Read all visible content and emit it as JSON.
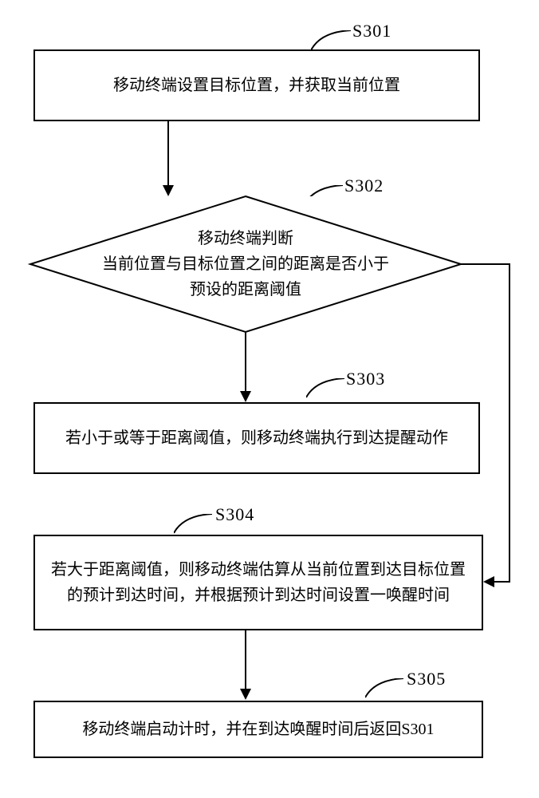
{
  "steps": {
    "s301": {
      "label": "S301",
      "text": "移动终端设置目标位置，并获取当前位置"
    },
    "s302": {
      "label": "S302",
      "text": "移动终端判断\n当前位置与目标位置之间的距离是否小于\n预设的距离阈值"
    },
    "s303": {
      "label": "S303",
      "text": "若小于或等于距离阈值，则移动终端执行到达提醒动作"
    },
    "s304": {
      "label": "S304",
      "text": "若大于距离阈值，则移动终端估算从当前位置到达目标位置的预计到达时间，并根据预计到达时间设置一唤醒时间"
    },
    "s305": {
      "label": "S305",
      "text": "移动终端启动计时，并在到达唤醒时间后返回S301"
    }
  }
}
